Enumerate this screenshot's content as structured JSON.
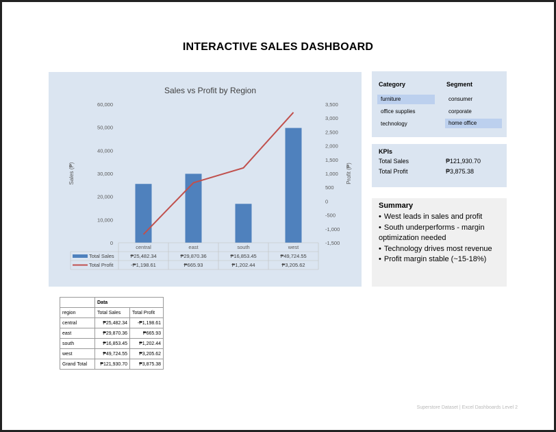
{
  "page": {
    "title": "INTERACTIVE SALES DASHBOARD",
    "footer": "Superstore Dataset | Excel Dashboards Level 2"
  },
  "chart_data": {
    "type": "bar",
    "title": "Sales vs Profit by Region",
    "categories": [
      "central",
      "east",
      "south",
      "west"
    ],
    "ylabel": "Sales (₱)",
    "y2label": "Profit (₱)",
    "ylim": [
      0,
      60000
    ],
    "y2lim": [
      -1500,
      3500
    ],
    "y_ticks": [
      "0",
      "10,000",
      "20,000",
      "30,000",
      "40,000",
      "50,000",
      "60,000"
    ],
    "y2_ticks": [
      "-1,500",
      "-1,000",
      "-500",
      "0",
      "500",
      "1,000",
      "1,500",
      "2,000",
      "2,500",
      "3,000",
      "3,500"
    ],
    "series": [
      {
        "name": "Total Sales",
        "kind": "bar",
        "axis": "left",
        "color": "#4f81bd",
        "values": [
          25482.34,
          29870.36,
          16853.45,
          49724.55
        ],
        "labels": [
          "₱25,482.34",
          "₱29,870.36",
          "₱16,853.45",
          "₱49,724.55"
        ]
      },
      {
        "name": "Total Profit",
        "kind": "line",
        "axis": "right",
        "color": "#c0504d",
        "values": [
          -1198.61,
          665.93,
          1202.44,
          3205.62
        ],
        "labels": [
          "-₱1,198.61",
          "₱665.93",
          "₱1,202.44",
          "₱3,205.62"
        ]
      }
    ],
    "data_table": true,
    "grid": false
  },
  "slicers": {
    "category": {
      "title": "Category",
      "items": [
        {
          "label": "furniture",
          "selected": true
        },
        {
          "label": "office supplies",
          "selected": false
        },
        {
          "label": "technology",
          "selected": false
        }
      ]
    },
    "segment": {
      "title": "Segment",
      "items": [
        {
          "label": "consumer",
          "selected": false
        },
        {
          "label": "corporate",
          "selected": false
        },
        {
          "label": "home office",
          "selected": true
        }
      ]
    }
  },
  "kpis": {
    "title": "KPIs",
    "items": [
      {
        "label": "Total Sales",
        "value": "₱121,930.70"
      },
      {
        "label": "Total Profit",
        "value": "₱3,875.38"
      }
    ]
  },
  "summary": {
    "title": "Summary",
    "bullets": [
      "West leads in sales and profit",
      "South underperforms - margin optimization needed",
      "Technology drives most revenue",
      "Profit margin stable (~15-18%)"
    ]
  },
  "pivot": {
    "data_header": "Data",
    "row_header": "region",
    "col_sales": "Total Sales",
    "col_profit": "Total Profit",
    "rows": [
      {
        "region": "central",
        "sales": "₱25,482.34",
        "profit": "-₱1,198.61"
      },
      {
        "region": "east",
        "sales": "₱29,870.36",
        "profit": "₱665.93"
      },
      {
        "region": "south",
        "sales": "₱16,853.45",
        "profit": "₱1,202.44"
      },
      {
        "region": "west",
        "sales": "₱49,724.55",
        "profit": "₱3,205.62"
      }
    ],
    "total": {
      "region": "Grand Total",
      "sales": "₱121,930.70",
      "profit": "₱3,875.38"
    }
  }
}
